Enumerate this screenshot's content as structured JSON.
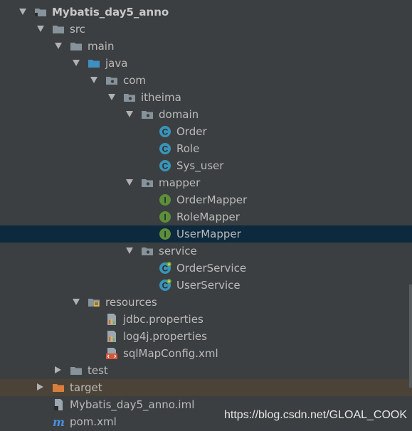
{
  "tree": [
    {
      "label": "Mybatis_day5_anno",
      "icon": "module-folder-icon",
      "depth": 1,
      "state": "expanded",
      "bold": true
    },
    {
      "label": "src",
      "icon": "folder-icon",
      "depth": 2,
      "state": "expanded"
    },
    {
      "label": "main",
      "icon": "folder-icon",
      "depth": 3,
      "state": "expanded"
    },
    {
      "label": "java",
      "icon": "source-folder-icon",
      "depth": 4,
      "state": "expanded"
    },
    {
      "label": "com",
      "icon": "package-icon",
      "depth": 5,
      "state": "expanded"
    },
    {
      "label": "itheima",
      "icon": "package-icon",
      "depth": 6,
      "state": "expanded"
    },
    {
      "label": "domain",
      "icon": "package-icon",
      "depth": 7,
      "state": "expanded"
    },
    {
      "label": "Order",
      "icon": "class-icon",
      "depth": 8,
      "state": "leaf"
    },
    {
      "label": "Role",
      "icon": "class-icon",
      "depth": 8,
      "state": "leaf"
    },
    {
      "label": "Sys_user",
      "icon": "class-icon",
      "depth": 8,
      "state": "leaf"
    },
    {
      "label": "mapper",
      "icon": "package-icon",
      "depth": 7,
      "state": "expanded"
    },
    {
      "label": "OrderMapper",
      "icon": "interface-icon",
      "depth": 8,
      "state": "leaf"
    },
    {
      "label": "RoleMapper",
      "icon": "interface-icon",
      "depth": 8,
      "state": "leaf"
    },
    {
      "label": "UserMapper",
      "icon": "interface-icon",
      "depth": 8,
      "state": "leaf",
      "selected": true
    },
    {
      "label": "service",
      "icon": "package-icon",
      "depth": 7,
      "state": "expanded"
    },
    {
      "label": "OrderService",
      "icon": "spring-class-icon",
      "depth": 8,
      "state": "leaf"
    },
    {
      "label": "UserService",
      "icon": "spring-class-icon",
      "depth": 8,
      "state": "leaf"
    },
    {
      "label": "resources",
      "icon": "resources-folder-icon",
      "depth": 4,
      "state": "expanded"
    },
    {
      "label": "jdbc.properties",
      "icon": "properties-file-icon",
      "depth": 5,
      "state": "leaf"
    },
    {
      "label": "log4j.properties",
      "icon": "properties-file-icon",
      "depth": 5,
      "state": "leaf"
    },
    {
      "label": "sqlMapConfig.xml",
      "icon": "xml-file-icon",
      "depth": 5,
      "state": "leaf"
    },
    {
      "label": "test",
      "icon": "folder-icon",
      "depth": 3,
      "state": "collapsed"
    },
    {
      "label": "target",
      "icon": "excluded-folder-icon",
      "depth": 2,
      "state": "collapsed",
      "excluded": true
    },
    {
      "label": "Mybatis_day5_anno.iml",
      "icon": "iml-file-icon",
      "depth": 2,
      "state": "leaf"
    },
    {
      "label": "pom.xml",
      "icon": "maven-icon",
      "depth": 2,
      "state": "leaf"
    }
  ],
  "watermark": "https://blog.csdn.net/GLOAL_COOK",
  "colors": {
    "background": "#3c3f41",
    "selection": "#0d293e",
    "excluded_row": "#4b4337",
    "folder": "#87939a",
    "source_folder": "#3f8fc1",
    "class_badge": "#3a94b8",
    "interface_badge": "#5c8f3b",
    "excluded_folder": "#d87f3d",
    "text": "#bbbbbb"
  }
}
